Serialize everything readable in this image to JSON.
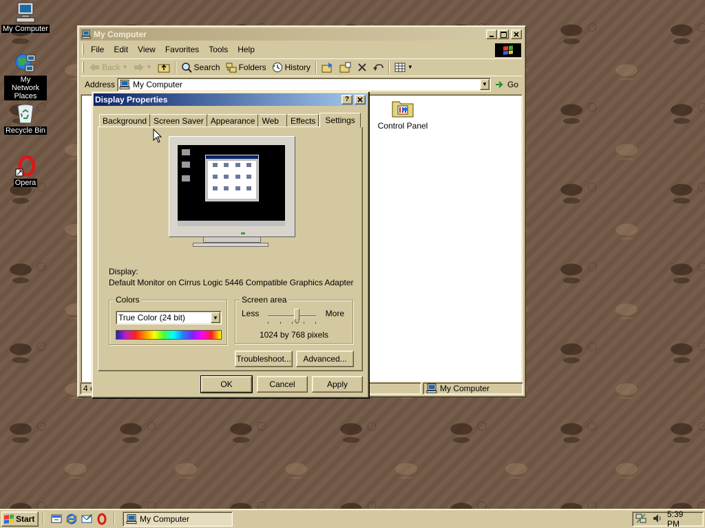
{
  "desktop": {
    "icons": [
      {
        "label": "My Computer",
        "icon": "computer-icon"
      },
      {
        "label": "My Network Places",
        "icon": "network-icon"
      },
      {
        "label": "Recycle Bin",
        "icon": "recycle-bin-icon"
      },
      {
        "label": "Opera",
        "icon": "opera-icon"
      }
    ]
  },
  "explorer": {
    "title": "My Computer",
    "menu": [
      "File",
      "Edit",
      "View",
      "Favorites",
      "Tools",
      "Help"
    ],
    "toolbar": {
      "back_label": "Back",
      "search_label": "Search",
      "folders_label": "Folders",
      "history_label": "History"
    },
    "address": {
      "label": "Address",
      "value": "My Computer",
      "go_label": "Go"
    },
    "items": [
      {
        "label": "Control Panel",
        "icon": "control-panel-icon"
      }
    ],
    "status": {
      "left": "4 o",
      "right": "My Computer"
    }
  },
  "dialog": {
    "title": "Display Properties",
    "tabs": [
      "Background",
      "Screen Saver",
      "Appearance",
      "Web",
      "Effects",
      "Settings"
    ],
    "active_tab": "Settings",
    "display_label": "Display:",
    "display_value": "Default Monitor on Cirrus Logic 5446 Compatible Graphics Adapter",
    "colors": {
      "title": "Colors",
      "selected": "True Color (24 bit)"
    },
    "screen_area": {
      "title": "Screen area",
      "less_label": "Less",
      "more_label": "More",
      "value_text": "1024 by 768 pixels",
      "slider_position": 0.6
    },
    "troubleshoot_label": "Troubleshoot...",
    "advanced_label": "Advanced...",
    "ok_label": "OK",
    "cancel_label": "Cancel",
    "apply_label": "Apply"
  },
  "taskbar": {
    "start_label": "Start",
    "quick_launch": [
      "show-desktop-icon",
      "internet-explorer-icon",
      "outlook-express-icon",
      "opera-icon"
    ],
    "tasks": [
      {
        "label": "My Computer"
      }
    ],
    "clock": "5:39 PM"
  },
  "colors": {
    "face": "#d4c8a0",
    "active_title": "#0a246a",
    "inactive_title": "#b3a37c",
    "desktop": "#6e5442"
  }
}
